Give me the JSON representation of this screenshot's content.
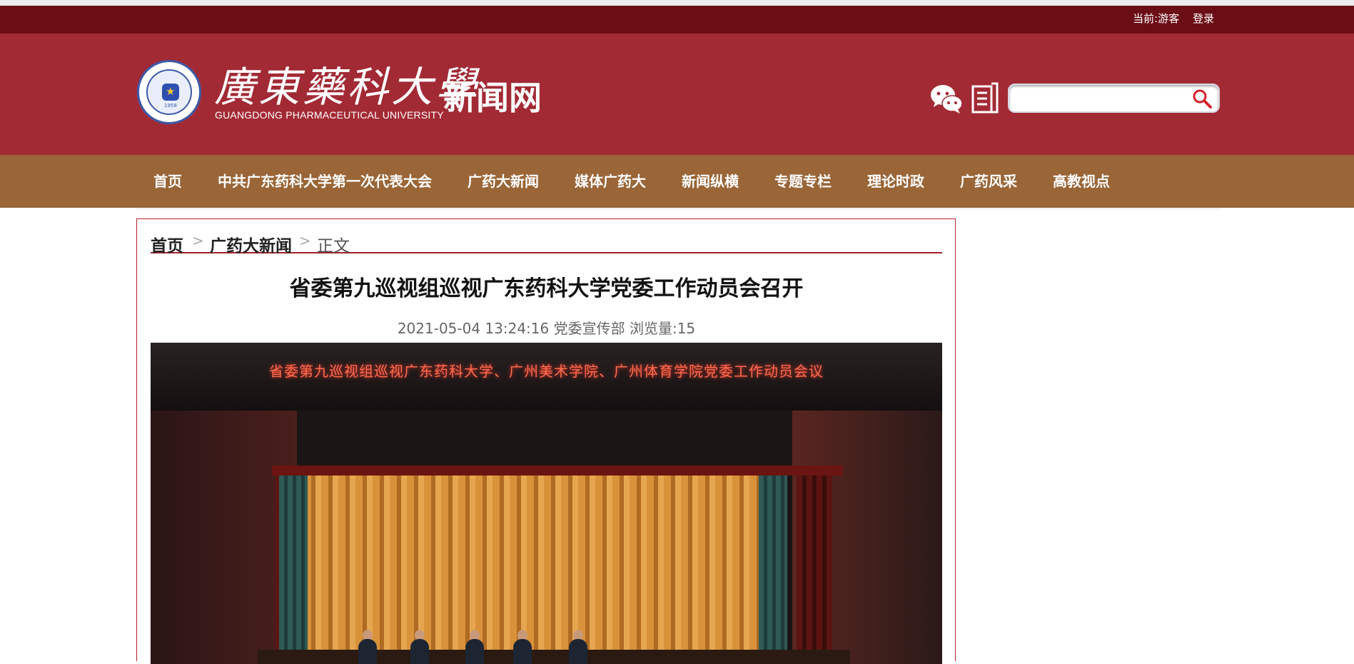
{
  "topbar": {
    "current_user": "当前:游客",
    "login": "登录"
  },
  "header": {
    "university_cn": "廣東藥科大學",
    "university_en": "GUANGDONG PHARMACEUTICAL UNIVERSITY",
    "site_name": "新闻网",
    "logo_year": "1958",
    "logo_abbr": "GDPU",
    "icons": [
      "wechat-icon",
      "document-icon",
      "search-icon"
    ],
    "search": {
      "value": "",
      "placeholder": ""
    }
  },
  "nav": {
    "items": [
      "首页",
      "中共广东药科大学第一次代表大会",
      "广药大新闻",
      "媒体广药大",
      "新闻纵横",
      "专题专栏",
      "理论时政",
      "广药风采",
      "高教视点"
    ]
  },
  "breadcrumb": {
    "home": "首页",
    "section": "广药大新闻",
    "current": "正文",
    "separator": ">"
  },
  "article": {
    "title": "省委第九巡视组巡视广东药科大学党委工作动员会召开",
    "meta": "2021-05-04 13:24:16 党委宣传部 浏览量:15",
    "photo_banner": "省委第九巡视组巡视广东药科大学、广州美术学院、广州体育学院党委工作动员会议"
  },
  "colors": {
    "topbar": "#6b0d15",
    "header": "#a22a35",
    "nav": "#9a6537",
    "accent": "#a31f2c"
  }
}
